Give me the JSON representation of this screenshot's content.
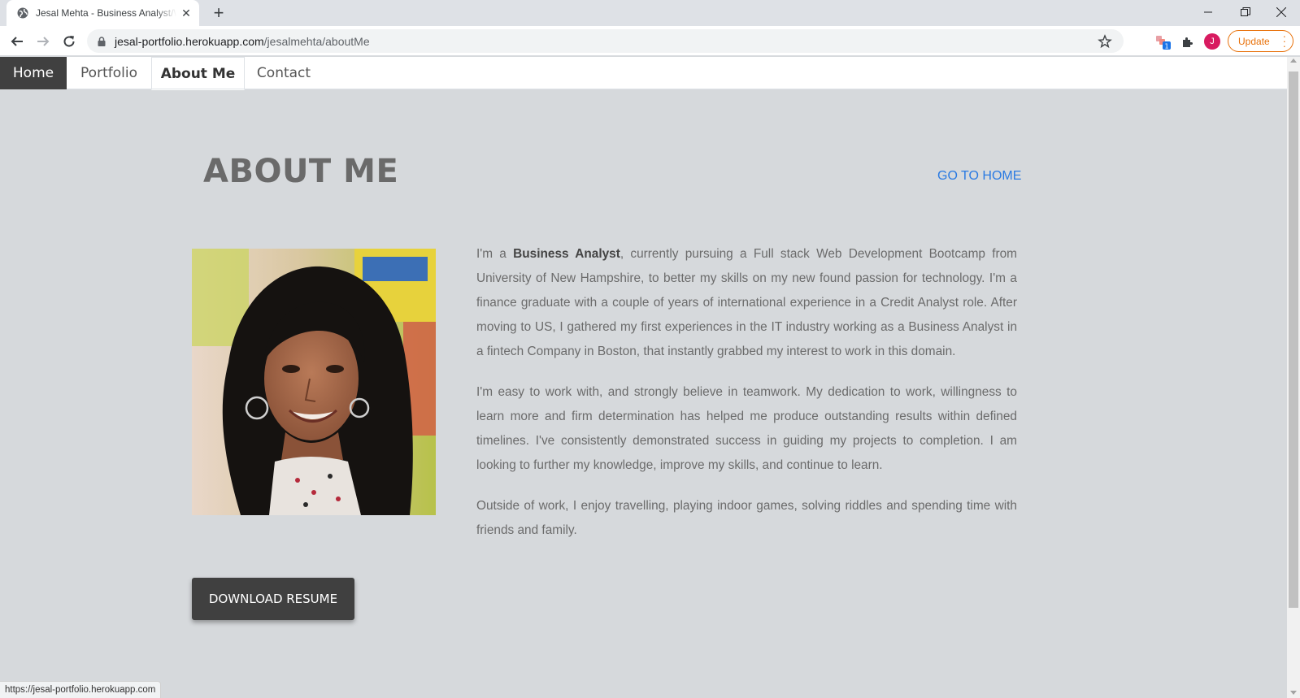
{
  "browser": {
    "tab_title": "Jesal Mehta - Business Analyst/Web Developer",
    "url_host": "jesal-portfolio.herokuapp.com",
    "url_path": "/jesalmehta/aboutMe",
    "profile_initial": "J",
    "update_label": "Update",
    "extension_badge": "1",
    "status_url": "https://jesal-portfolio.herokuapp.com"
  },
  "nav": {
    "items": [
      {
        "label": "Home"
      },
      {
        "label": "Portfolio"
      },
      {
        "label": "About Me"
      },
      {
        "label": "Contact"
      }
    ]
  },
  "about": {
    "heading": "ABOUT ME",
    "go_home": "GO TO HOME",
    "intro_prefix": "I'm a ",
    "intro_role": "Business Analyst",
    "intro_rest": ", currently pursuing a Full stack Web Development Bootcamp from University of New Hampshire, to better my skills on my new found passion for technology. I'm a finance graduate with a couple of years of international experience in a Credit Analyst role. After moving to US, I gathered my first experiences in the IT industry working as a Business Analyst in a fintech Company in Boston, that instantly grabbed my interest to work in this domain.",
    "para2": "I'm easy to work with, and strongly believe in teamwork. My dedication to work, willingness to learn more and firm determination has helped me produce outstanding results within defined timelines. I've consistently demonstrated success in guiding my projects to completion. I am looking to further my knowledge, improve my skills, and continue to learn.",
    "para3": "Outside of work, I enjoy travelling, playing indoor games, solving riddles and spending time with friends and family.",
    "resume_button": "DOWNLOAD RESUME"
  },
  "colors": {
    "accent_link": "#2a7ae2",
    "nav_active_bg": "#404040",
    "page_bg": "#d6d9dc"
  }
}
